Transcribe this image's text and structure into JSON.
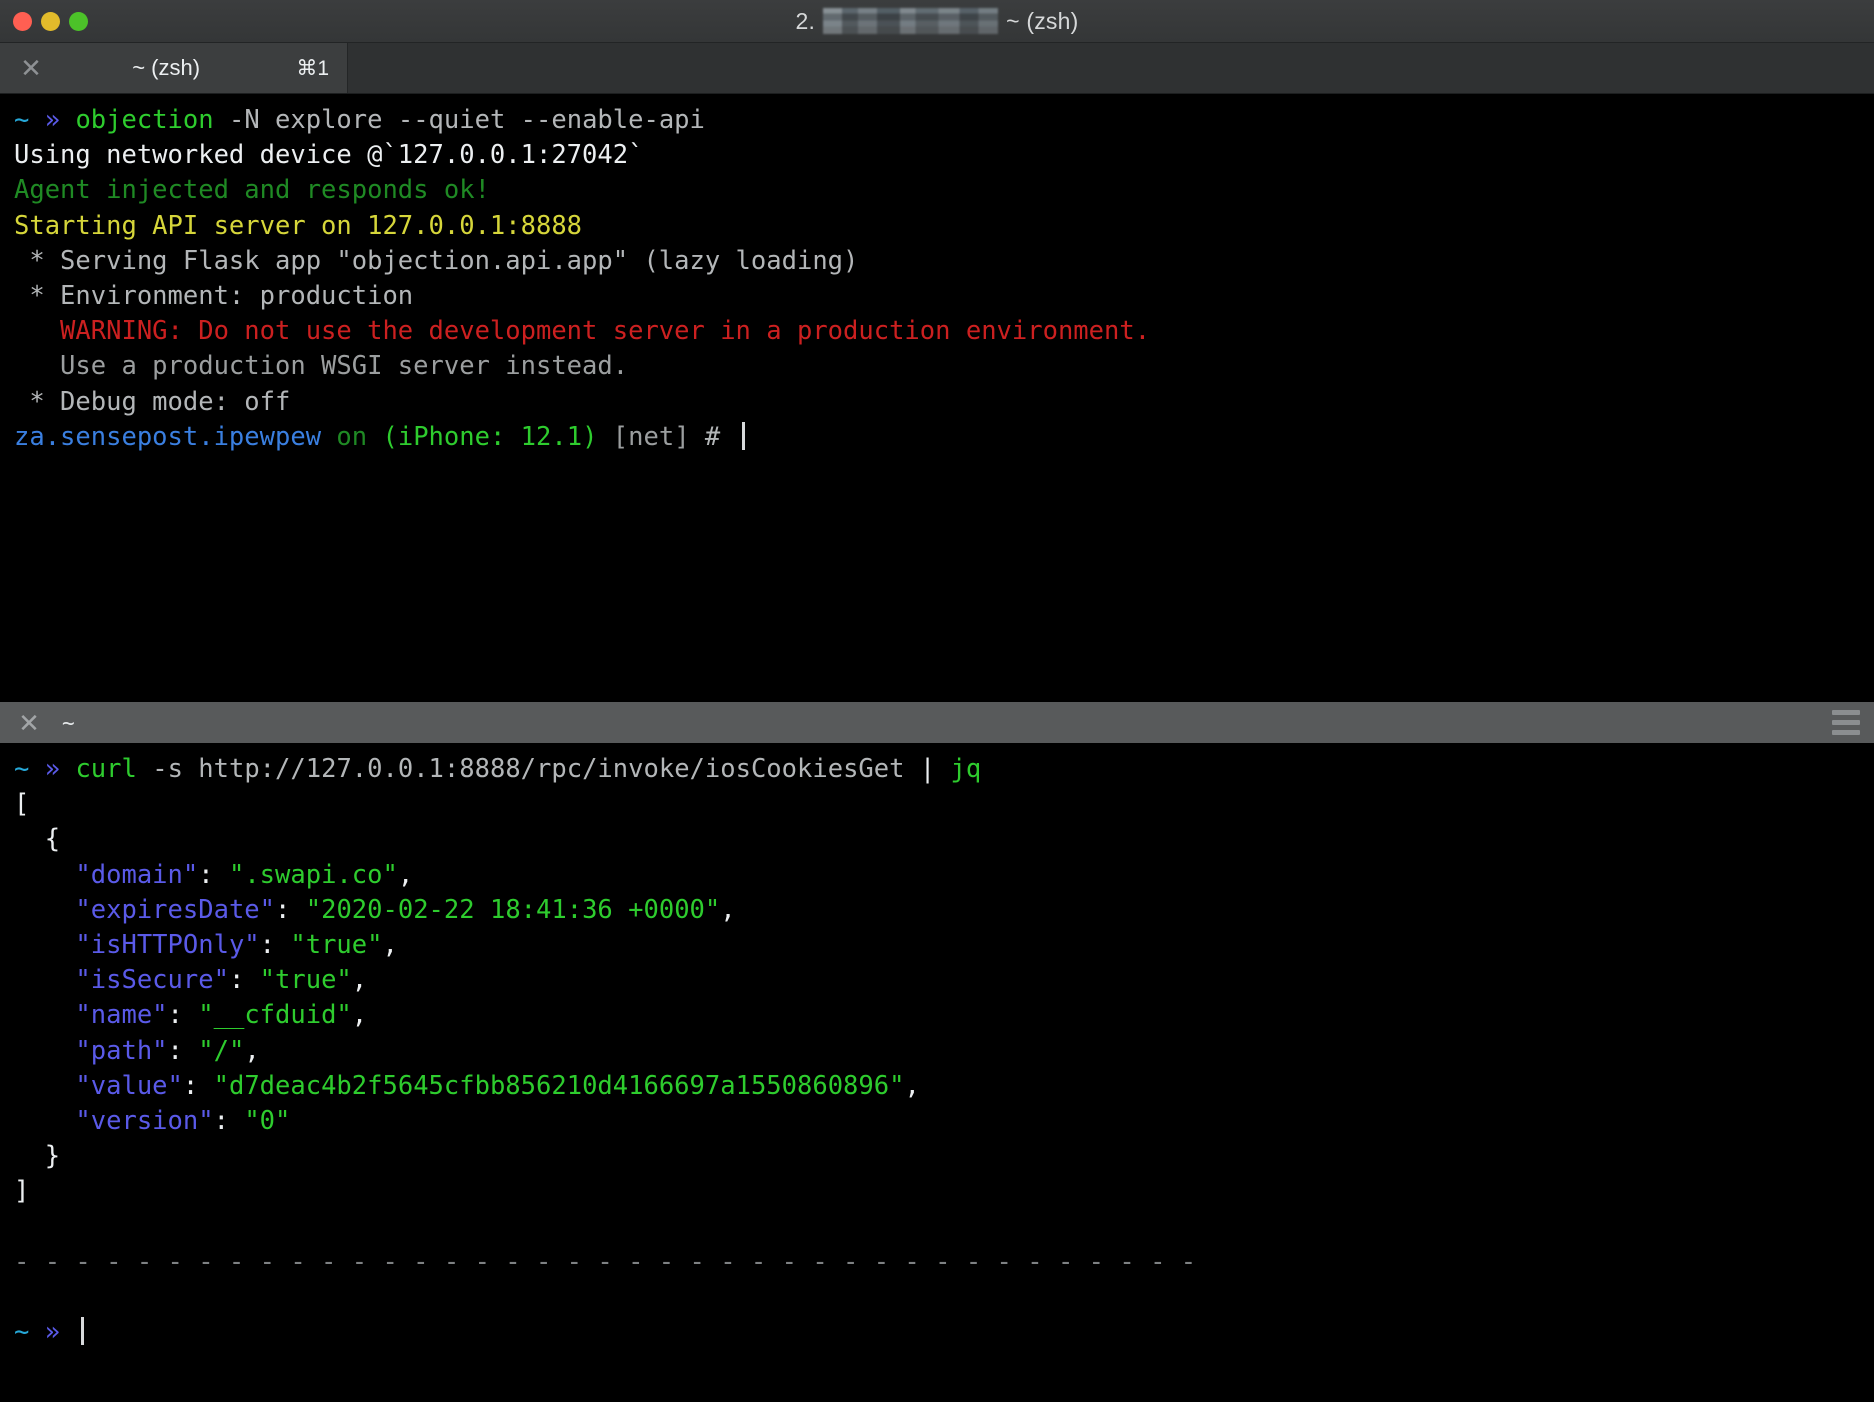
{
  "window": {
    "title_prefix": "2.",
    "title_suffix": "~ (zsh)",
    "redacted": true,
    "traffic_lights": {
      "close_color": "#ff5f52",
      "minimize_color": "#e2bb2b",
      "maximize_color": "#4cc229"
    }
  },
  "tabbar": {
    "close_glyph": "✕",
    "tab_title": "~ (zsh)",
    "shortcut": "⌘1"
  },
  "pane_top": {
    "lines": [
      {
        "segments": [
          {
            "text": "~",
            "color": "cyan"
          },
          {
            "text": " ",
            "color": "white"
          },
          {
            "text": "»",
            "color": "violet"
          },
          {
            "text": " ",
            "color": "white"
          },
          {
            "text": "objection",
            "color": "green"
          },
          {
            "text": " -N explore --quiet --enable-api",
            "color": "grey"
          }
        ]
      },
      {
        "segments": [
          {
            "text": "Using networked device @`127.0.0.1:27042`",
            "color": "white"
          }
        ]
      },
      {
        "segments": [
          {
            "text": "Agent injected and responds ok!",
            "color": "dgreen"
          }
        ]
      },
      {
        "segments": [
          {
            "text": "Starting API server on 127.0.0.1:8888",
            "color": "yellow"
          }
        ]
      },
      {
        "segments": [
          {
            "text": " * Serving Flask app \"objection.api.app\" (lazy loading)",
            "color": "grey"
          }
        ]
      },
      {
        "segments": [
          {
            "text": " * Environment: production",
            "color": "grey"
          }
        ]
      },
      {
        "segments": [
          {
            "text": "   WARNING: Do not use the development server in a production environment.",
            "color": "red"
          }
        ]
      },
      {
        "segments": [
          {
            "text": "   Use a production WSGI server instead.",
            "color": "dim"
          }
        ]
      },
      {
        "segments": [
          {
            "text": " * Debug mode: off",
            "color": "grey"
          }
        ]
      },
      {
        "segments": [
          {
            "text": "za.sensepost.ipewpew",
            "color": "blue"
          },
          {
            "text": " ",
            "color": "white"
          },
          {
            "text": "on",
            "color": "dgreen"
          },
          {
            "text": " ",
            "color": "white"
          },
          {
            "text": "(iPhone: 12.1)",
            "color": "green"
          },
          {
            "text": " ",
            "color": "white"
          },
          {
            "text": "[net]",
            "color": "dim"
          },
          {
            "text": " # ",
            "color": "grey"
          }
        ],
        "cursor": true
      }
    ]
  },
  "pane_bottom_header": {
    "close_glyph": "✕",
    "title": "~",
    "menu_icon": "hamburger-icon"
  },
  "pane_bottom": {
    "lines": [
      {
        "segments": [
          {
            "text": "~",
            "color": "cyan"
          },
          {
            "text": " ",
            "color": "white"
          },
          {
            "text": "»",
            "color": "violet"
          },
          {
            "text": " ",
            "color": "white"
          },
          {
            "text": "curl",
            "color": "green"
          },
          {
            "text": " -s http://127.0.0.1:8888/rpc/invoke/iosCookiesGet ",
            "color": "grey"
          },
          {
            "text": "|",
            "color": "white"
          },
          {
            "text": " ",
            "color": "white"
          },
          {
            "text": "jq",
            "color": "green"
          }
        ]
      },
      {
        "segments": [
          {
            "text": "[",
            "color": "white"
          }
        ]
      },
      {
        "segments": [
          {
            "text": "  {",
            "color": "white"
          }
        ]
      },
      {
        "segments": [
          {
            "text": "    ",
            "color": "white"
          },
          {
            "text": "\"domain\"",
            "color": "violet"
          },
          {
            "text": ": ",
            "color": "white"
          },
          {
            "text": "\".swapi.co\"",
            "color": "green"
          },
          {
            "text": ",",
            "color": "white"
          }
        ]
      },
      {
        "segments": [
          {
            "text": "    ",
            "color": "white"
          },
          {
            "text": "\"expiresDate\"",
            "color": "violet"
          },
          {
            "text": ": ",
            "color": "white"
          },
          {
            "text": "\"2020-02-22 18:41:36 +0000\"",
            "color": "green"
          },
          {
            "text": ",",
            "color": "white"
          }
        ]
      },
      {
        "segments": [
          {
            "text": "    ",
            "color": "white"
          },
          {
            "text": "\"isHTTPOnly\"",
            "color": "violet"
          },
          {
            "text": ": ",
            "color": "white"
          },
          {
            "text": "\"true\"",
            "color": "green"
          },
          {
            "text": ",",
            "color": "white"
          }
        ]
      },
      {
        "segments": [
          {
            "text": "    ",
            "color": "white"
          },
          {
            "text": "\"isSecure\"",
            "color": "violet"
          },
          {
            "text": ": ",
            "color": "white"
          },
          {
            "text": "\"true\"",
            "color": "green"
          },
          {
            "text": ",",
            "color": "white"
          }
        ]
      },
      {
        "segments": [
          {
            "text": "    ",
            "color": "white"
          },
          {
            "text": "\"name\"",
            "color": "violet"
          },
          {
            "text": ": ",
            "color": "white"
          },
          {
            "text": "\"__cfduid\"",
            "color": "green"
          },
          {
            "text": ",",
            "color": "white"
          }
        ]
      },
      {
        "segments": [
          {
            "text": "    ",
            "color": "white"
          },
          {
            "text": "\"path\"",
            "color": "violet"
          },
          {
            "text": ": ",
            "color": "white"
          },
          {
            "text": "\"/\"",
            "color": "green"
          },
          {
            "text": ",",
            "color": "white"
          }
        ]
      },
      {
        "segments": [
          {
            "text": "    ",
            "color": "white"
          },
          {
            "text": "\"value\"",
            "color": "violet"
          },
          {
            "text": ": ",
            "color": "white"
          },
          {
            "text": "\"d7deac4b2f5645cfbb856210d4166697a1550860896\"",
            "color": "green"
          },
          {
            "text": ",",
            "color": "white"
          }
        ]
      },
      {
        "segments": [
          {
            "text": "    ",
            "color": "white"
          },
          {
            "text": "\"version\"",
            "color": "violet"
          },
          {
            "text": ": ",
            "color": "white"
          },
          {
            "text": "\"0\"",
            "color": "green"
          }
        ]
      },
      {
        "segments": [
          {
            "text": "  }",
            "color": "white"
          }
        ]
      },
      {
        "segments": [
          {
            "text": "]",
            "color": "white"
          }
        ]
      },
      {
        "segments": [
          {
            "text": "",
            "color": "white"
          }
        ]
      },
      {
        "segments": [
          {
            "text": "- - - - - - - - - - - - - - - - - - - - - - - - - - - - - - - - - - - - - - -",
            "color": "dash"
          }
        ]
      },
      {
        "segments": [
          {
            "text": "",
            "color": "white"
          }
        ]
      },
      {
        "segments": [
          {
            "text": "~",
            "color": "cyan"
          },
          {
            "text": " ",
            "color": "white"
          },
          {
            "text": "»",
            "color": "violet"
          },
          {
            "text": " ",
            "color": "white"
          }
        ],
        "cursor": true
      }
    ]
  }
}
